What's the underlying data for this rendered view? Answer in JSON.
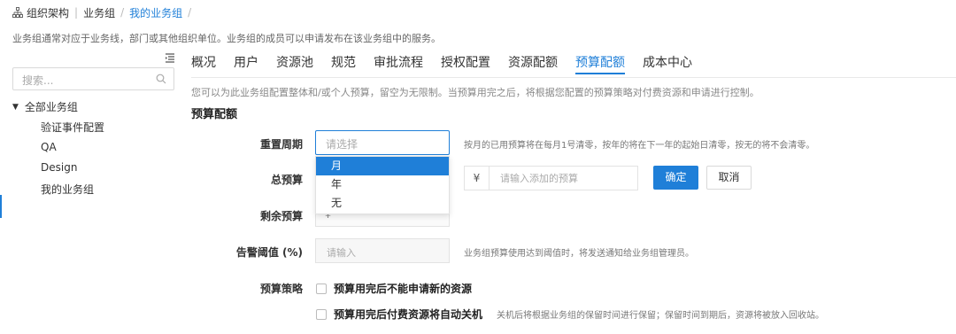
{
  "breadcrumb": {
    "items": [
      "组织架构",
      "业务组",
      "我的业务组"
    ],
    "separator": "|",
    "trailing": "/"
  },
  "description": "业务组通常对应于业务线，部门或其他组织单位。业务组的成员可以申请发布在该业务组中的服务。",
  "sidebar": {
    "search_placeholder": "搜索...",
    "root_label": "全部业务组",
    "items": [
      "验证事件配置",
      "QA",
      "Design",
      "我的业务组"
    ]
  },
  "tabs": [
    "概况",
    "用户",
    "资源池",
    "规范",
    "审批流程",
    "授权配置",
    "资源配额",
    "预算配额",
    "成本中心"
  ],
  "active_tab": "预算配额",
  "info_text": "您可以为此业务组配置整体和/或个人预算，留空为无限制。当预算用完之后，将根据您配置的预算策略对付费资源和申请进行控制。",
  "section_title": "预算配额",
  "form": {
    "reset_period": {
      "label": "重置周期",
      "placeholder": "请选择",
      "options": [
        "月",
        "年",
        "无"
      ],
      "highlighted": "月",
      "hint": "按月的已用预算将在每月1号清零，按年的将在下一年的起始日清零，按无的将不会清零。"
    },
    "total_budget": {
      "label": "总预算",
      "currency": "¥",
      "placeholder": "请输入添加的预算",
      "confirm": "确定",
      "cancel": "取消"
    },
    "remaining_budget": {
      "label": "剩余预算",
      "value": "¥"
    },
    "warning_threshold": {
      "label": "告警阈值 (%)",
      "placeholder": "请输入",
      "hint": "业务组预算使用达到阈值时，将发送通知给业务组管理员。"
    },
    "policy": {
      "label": "预算策略",
      "options": [
        {
          "label": "预算用完后不能申请新的资源",
          "hint": ""
        },
        {
          "label": "预算用完后付费资源将自动关机",
          "hint": "关机后将根据业务组的保留时间进行保留；保留时间到期后，资源将被放入回收站。"
        }
      ]
    }
  },
  "colors": {
    "accent": "#1f7fd8"
  }
}
